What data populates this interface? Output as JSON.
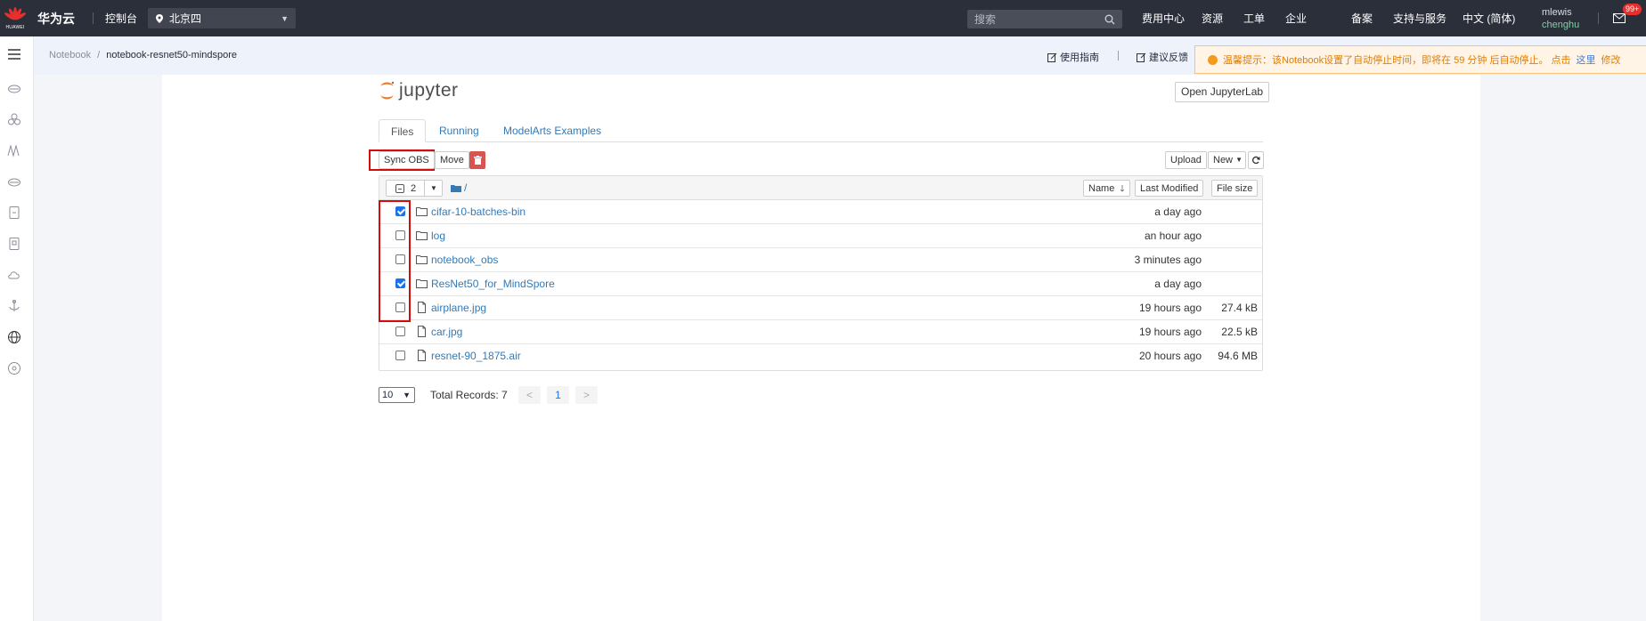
{
  "topbar": {
    "logo_text": "HUAWEI",
    "brand": "华为云",
    "console": "控制台",
    "region": "北京四",
    "search_placeholder": "搜索",
    "nav": [
      "费用中心",
      "资源",
      "工单",
      "企业",
      "备案",
      "支持与服务",
      "中文 (简体)"
    ],
    "username": "mlewis",
    "org": "chenghu",
    "mail_badge": "99+"
  },
  "breadcrumb": {
    "root": "Notebook",
    "sep": "/",
    "current": "notebook-resnet50-mindspore"
  },
  "header_links": {
    "guide": "使用指南",
    "feedback": "建议反馈"
  },
  "notice": {
    "text": "温馨提示：该Notebook设置了自动停止时间，即将在 59 分钟 后自动停止。 点击",
    "here": "这里",
    "modify": "修改"
  },
  "jupyter": {
    "logo": "jupyter",
    "open_lab": "Open JupyterLab",
    "tabs": [
      "Files",
      "Running",
      "ModelArts Examples"
    ],
    "active_tab": "Files"
  },
  "toolbar": {
    "sync_obs": "Sync OBS",
    "move": "Move",
    "upload": "Upload",
    "new": "New",
    "selected_count": "2",
    "path": "/"
  },
  "list_header": {
    "name": "Name",
    "last_modified": "Last Modified",
    "file_size": "File size"
  },
  "files": [
    {
      "name": "cifar-10-batches-bin",
      "type": "folder",
      "modified": "a day ago",
      "size": "",
      "checked": true
    },
    {
      "name": "log",
      "type": "folder",
      "modified": "an hour ago",
      "size": "",
      "checked": false
    },
    {
      "name": "notebook_obs",
      "type": "folder",
      "modified": "3 minutes ago",
      "size": "",
      "checked": false
    },
    {
      "name": "ResNet50_for_MindSpore",
      "type": "folder",
      "modified": "a day ago",
      "size": "",
      "checked": true
    },
    {
      "name": "airplane.jpg",
      "type": "file",
      "modified": "19 hours ago",
      "size": "27.4 kB",
      "checked": false
    },
    {
      "name": "car.jpg",
      "type": "file",
      "modified": "19 hours ago",
      "size": "22.5 kB",
      "checked": false
    },
    {
      "name": "resnet-90_1875.air",
      "type": "file",
      "modified": "20 hours ago",
      "size": "94.6 MB",
      "checked": false
    }
  ],
  "pagination": {
    "page_size": "10",
    "total": "Total Records: 7",
    "prev": "<",
    "current": "1",
    "next": ">"
  },
  "colors": {
    "topbar": "#2b2f3a",
    "accent_link": "#337ab7",
    "highlight_box": "#d30d0d",
    "notice_text": "#e37d00"
  }
}
